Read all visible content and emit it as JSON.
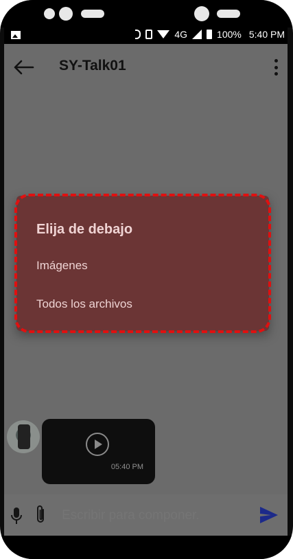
{
  "status_bar": {
    "battery": "100%",
    "time": "5:40 PM",
    "network": "4G"
  },
  "header": {
    "title": "SY-Talk01"
  },
  "dialog": {
    "title": "Elija de debajo",
    "options": [
      "Imágenes",
      "Todos los archivos"
    ]
  },
  "message": {
    "timestamp": "05:40 PM"
  },
  "composer": {
    "placeholder": "Escribir para componer."
  },
  "colors": {
    "dialog_bg": "#6b3535",
    "highlight_border": "#e01010",
    "send_accent": "#1c2a8a",
    "scrim": "#6b6b6b"
  }
}
